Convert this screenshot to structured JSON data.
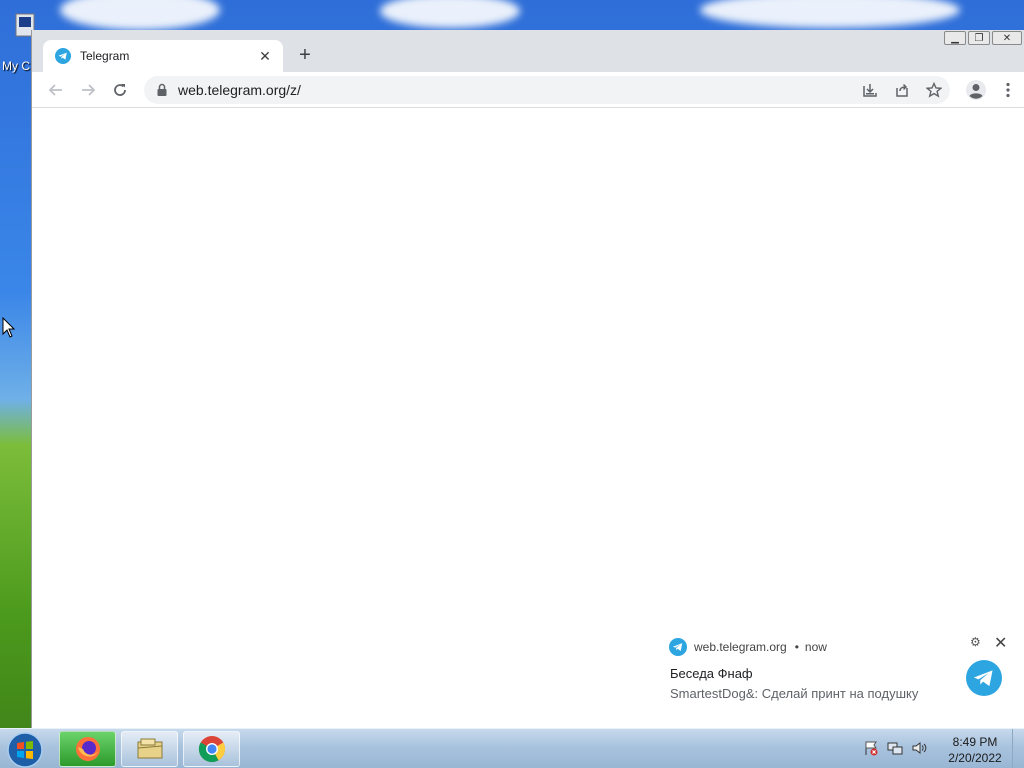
{
  "desktop": {
    "icon_label": "My C"
  },
  "browser": {
    "tab": {
      "title": "Telegram"
    },
    "address_bar": {
      "url": "web.telegram.org/z/"
    }
  },
  "notification": {
    "origin": "web.telegram.org",
    "separator": "•",
    "time": "now",
    "title": "Беседа Фнаф",
    "body": "SmartestDog&: Сделай принт на подушку"
  },
  "taskbar": {
    "clock_time": "8:49 PM",
    "clock_date": "2/20/2022"
  },
  "colors": {
    "telegram_blue": "#2ca5e0",
    "chrome_tab_strip": "#dee1e6"
  }
}
